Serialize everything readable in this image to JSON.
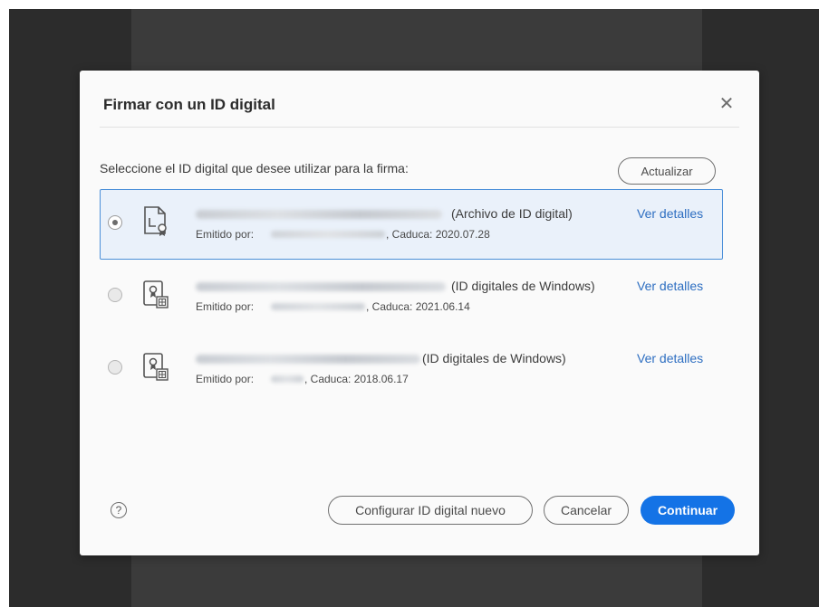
{
  "dialog": {
    "title": "Firmar con un ID digital",
    "close_icon": "close-icon",
    "instruction": "Seleccione el ID digital que desee utilizar para la firma:",
    "refresh_label": "Actualizar"
  },
  "ids": [
    {
      "selected": true,
      "icon": "certificate-file-icon",
      "type": "(Archivo de ID digital)",
      "issued_by_label": "Emitido por:",
      "expiry": ", Caduca: 2020.07.28",
      "details_label": "Ver detalles"
    },
    {
      "selected": false,
      "icon": "windows-certificate-icon",
      "type": "(ID digitales de Windows)",
      "issued_by_label": "Emitido por:",
      "expiry": ", Caduca: 2021.06.14",
      "details_label": "Ver detalles"
    },
    {
      "selected": false,
      "icon": "windows-certificate-icon",
      "type": "(ID digitales de Windows)",
      "issued_by_label": "Emitido por:",
      "expiry": ", Caduca: 2018.06.17",
      "details_label": "Ver detalles"
    }
  ],
  "footer": {
    "help_icon": "help-icon",
    "help_glyph": "?",
    "configure_label": "Configurar ID digital nuevo",
    "cancel_label": "Cancelar",
    "continue_label": "Continuar"
  },
  "colors": {
    "accent": "#1473e6",
    "link": "#2d6ec1",
    "selected_bg": "#eaf1fa",
    "selected_border": "#4b8fd8"
  }
}
